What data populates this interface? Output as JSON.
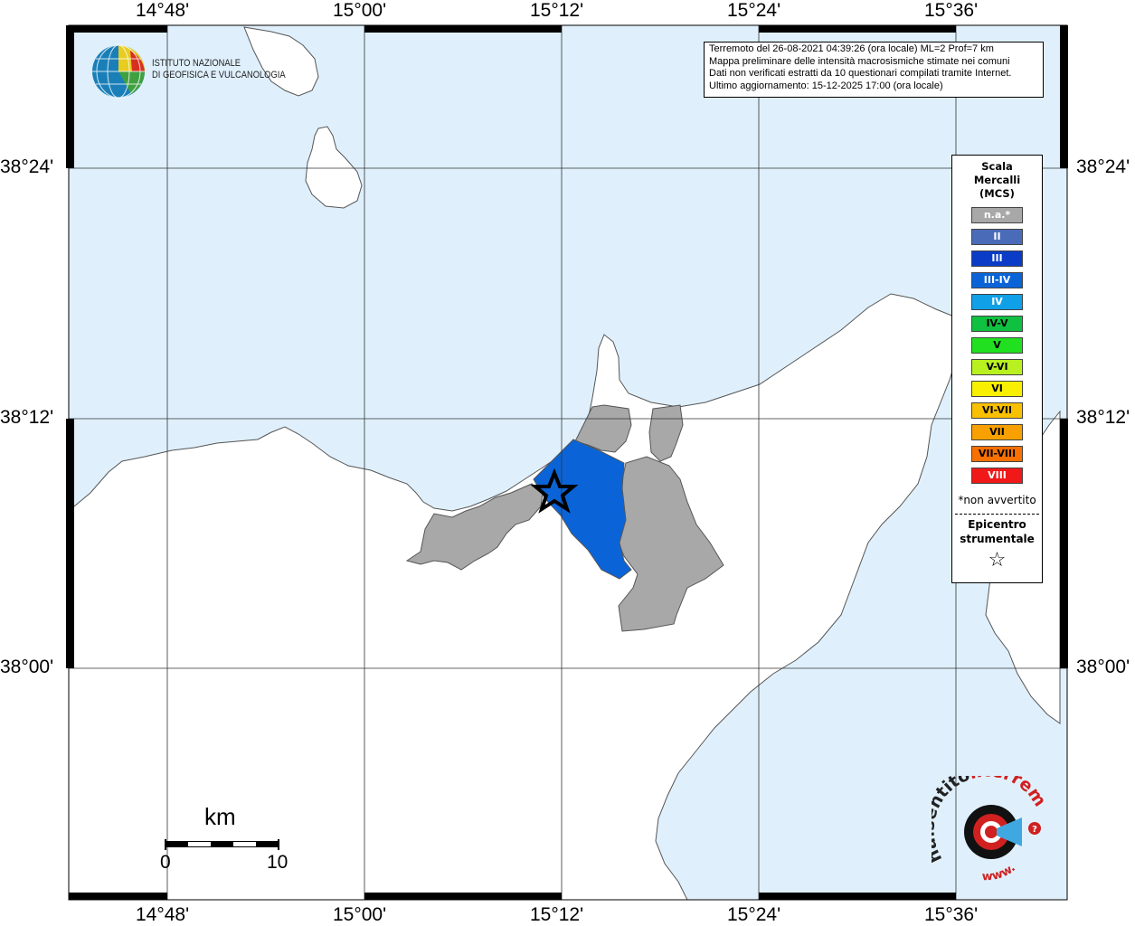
{
  "axes": {
    "top_labels": [
      "14°48'",
      "15°00'",
      "15°12'",
      "15°24'",
      "15°36'"
    ],
    "bottom_labels": [
      "14°48'",
      "15°00'",
      "15°12'",
      "15°24'",
      "15°36'"
    ],
    "left_labels": [
      "38°24'",
      "38°12'",
      "38°00'"
    ],
    "right_labels": [
      "38°24'",
      "38°12'",
      "38°00'"
    ]
  },
  "info": {
    "line1": "Terremoto del 26-08-2021 04:39:26 (ora locale) ML=2 Prof=7 km",
    "line2": "Mappa preliminare delle intensità macrosismiche stimate nei comuni",
    "line3": "Dati non verificati estratti da 10 questionari compilati tramite Internet.",
    "line4": "Ultimo aggiornamento: 15-12-2025 17:00 (ora locale)"
  },
  "logo": {
    "line1": "ISTITUTO NAZIONALE",
    "line2": "DI GEOFISICA E VULCANOLOGIA"
  },
  "legend": {
    "title1": "Scala",
    "title2": "Mercalli",
    "title3": "(MCS)",
    "items": [
      {
        "label": "n.a.*",
        "color": "#a8a8a8",
        "text": "#ffffff"
      },
      {
        "label": "II",
        "color": "#4a6cb8",
        "text": "#ffffff"
      },
      {
        "label": "III",
        "color": "#0a3cc8",
        "text": "#ffffff"
      },
      {
        "label": "III-IV",
        "color": "#0a64d8",
        "text": "#ffffff"
      },
      {
        "label": "IV",
        "color": "#10a0e8",
        "text": "#ffffff"
      },
      {
        "label": "IV-V",
        "color": "#10c040",
        "text": "#000000"
      },
      {
        "label": "V",
        "color": "#20e020",
        "text": "#000000"
      },
      {
        "label": "V-VI",
        "color": "#b8f020",
        "text": "#000000"
      },
      {
        "label": "VI",
        "color": "#f8f000",
        "text": "#000000"
      },
      {
        "label": "VI-VII",
        "color": "#f8c000",
        "text": "#000000"
      },
      {
        "label": "VII",
        "color": "#f8a000",
        "text": "#000000"
      },
      {
        "label": "VII-VIII",
        "color": "#f87000",
        "text": "#000000"
      },
      {
        "label": "VIII",
        "color": "#f01818",
        "text": "#ffffff"
      }
    ],
    "note": "*non avvertito",
    "epicenter1": "Epicentro",
    "epicenter2": "strumentale",
    "star": "☆"
  },
  "scalebar": {
    "unit": "km",
    "min": "0",
    "max": "10"
  },
  "site_logo": {
    "text_main": "haisentito",
    "text_accent": "ilterremoto.it",
    "text_www": "www."
  },
  "colors": {
    "sea": "#dff0fc",
    "land": "#ffffff",
    "na": "#a8a8a8",
    "intensity_iii_iv": "#0a64d8"
  }
}
